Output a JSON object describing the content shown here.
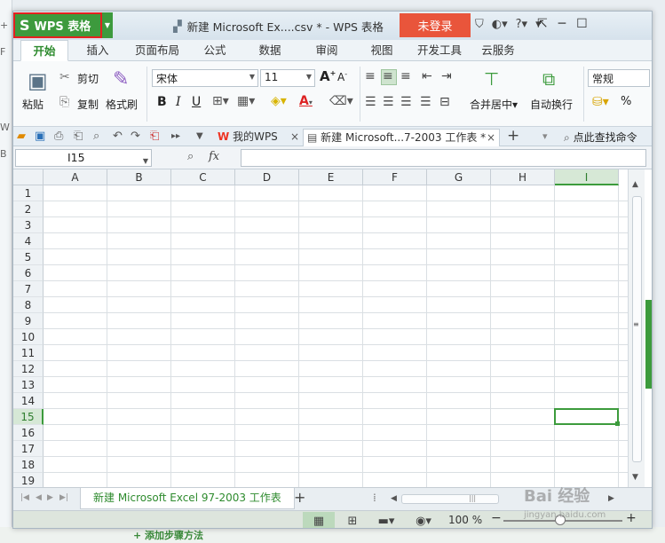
{
  "background": {
    "left_glyphs": [
      "+",
      "F",
      "W",
      "B"
    ],
    "bottom_text": "+ 添加步骤方法"
  },
  "titlebar": {
    "app_name": "WPS 表格",
    "app_logo": "S",
    "title": "新建 Microsoft Ex....csv * - WPS 表格",
    "login": "未登录",
    "help": "?",
    "icons": [
      "shirt-icon",
      "skin-icon",
      "help-icon",
      "arrow-down-icon"
    ]
  },
  "tabs": [
    "开始",
    "插入",
    "页面布局",
    "公式",
    "数据",
    "审阅",
    "视图",
    "开发工具",
    "云服务"
  ],
  "ribbon": {
    "paste": "粘贴",
    "cut": "剪切",
    "copy": "复制",
    "format_painter": "格式刷",
    "font_name": "宋体",
    "font_size": "11",
    "bold": "B",
    "italic": "I",
    "underline": "U",
    "font_color_glyph": "A",
    "grow": "A",
    "shrink": "A",
    "merge_center": "合并居中",
    "wrap_text": "自动换行",
    "number_format": "常规",
    "percent": "%",
    "accent_color": "#3c9b3c"
  },
  "docbar": {
    "tabs": [
      {
        "label": "我的WPS"
      },
      {
        "label": "新建 Microsoft...7-2003 工作表 *"
      }
    ],
    "add": "+",
    "find": "点此查找命令"
  },
  "formula_bar": {
    "name_box": "I15",
    "fx": "fx",
    "value": ""
  },
  "grid": {
    "columns": [
      "A",
      "B",
      "C",
      "D",
      "E",
      "F",
      "G",
      "H",
      "I"
    ],
    "rows": [
      "1",
      "2",
      "3",
      "4",
      "5",
      "6",
      "7",
      "8",
      "9",
      "10",
      "11",
      "12",
      "13",
      "14",
      "15",
      "16",
      "17",
      "18",
      "19"
    ],
    "selected_column": "I",
    "selected_row": "15"
  },
  "sheets": {
    "active": "新建 Microsoft Excel 97-2003 工作表",
    "add": "+"
  },
  "statusbar": {
    "zoom": "100 %",
    "zoom_minus": "−",
    "zoom_plus": "+"
  },
  "watermark": {
    "text": "Bai 经验",
    "url": "jingyan.baidu.com"
  }
}
